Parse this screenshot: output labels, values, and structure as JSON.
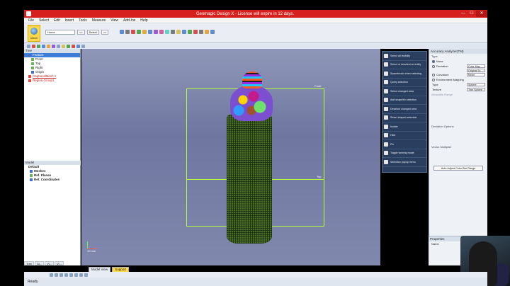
{
  "window": {
    "title": "Geomagic Design X - License will expire in 12 days."
  },
  "menu": [
    "File",
    "Select",
    "Edit",
    "Insert",
    "Tools",
    "Measure",
    "View",
    "Add-Ins",
    "Help"
  ],
  "ribbon": {
    "mesh_label": "Mesh",
    "home_select": "Home",
    "select_label": "Select"
  },
  "tree": {
    "title": "Tree",
    "items": [
      {
        "label": "Feature",
        "selected": true
      },
      {
        "label": "Front"
      },
      {
        "label": "Top"
      },
      {
        "label": "Right"
      },
      {
        "label": "Origin"
      },
      {
        "label": "CapturedMesh 1",
        "red": true
      },
      {
        "label": "Region Group1"
      }
    ]
  },
  "model": {
    "title": "Model",
    "items": [
      "Default",
      "Meshes",
      "Ref. Planes",
      "Ref. Coordinates"
    ]
  },
  "left_tabs": [
    "Tree",
    "Di...",
    "Vi...",
    "Vi..."
  ],
  "viewport": {
    "front_label": "Front",
    "right_label": "Right",
    "top_label": "Top",
    "scale_label": "10 mm"
  },
  "commands": [
    "Select all visibility",
    "Select or deselect an entity",
    "Spacebrush when selecting",
    "Query selection",
    "Select changed area",
    "Add shape/fix selection",
    "Deselect changed area",
    "Smart shaped selection",
    "Isolate",
    "Hide",
    "Pin",
    "Toggle viewing mode",
    "Selection popup menu"
  ],
  "accuracy": {
    "title": "Accuracy Analyzer(TM)",
    "type_label": "Type",
    "options": [
      "None",
      "Deviation",
      "Curvature",
      "Environment Mapping"
    ],
    "deviation_select": "Color Map",
    "compare_select": "Original Sc...",
    "curvature_select": "Mean",
    "type_select": "Sphere",
    "texture_label": "Texture",
    "texture_select": "True Sphere",
    "allowable_range": "Allowable Range",
    "deviation_options": "Deviation Options",
    "vector_multiplier": "Vector Multiplier",
    "adjust_button": "Auto Adjust Color Bar Range"
  },
  "properties": {
    "title": "Properties",
    "name_label": "Name"
  },
  "view_tabs": [
    "Model View",
    "Support"
  ],
  "status": "Ready"
}
